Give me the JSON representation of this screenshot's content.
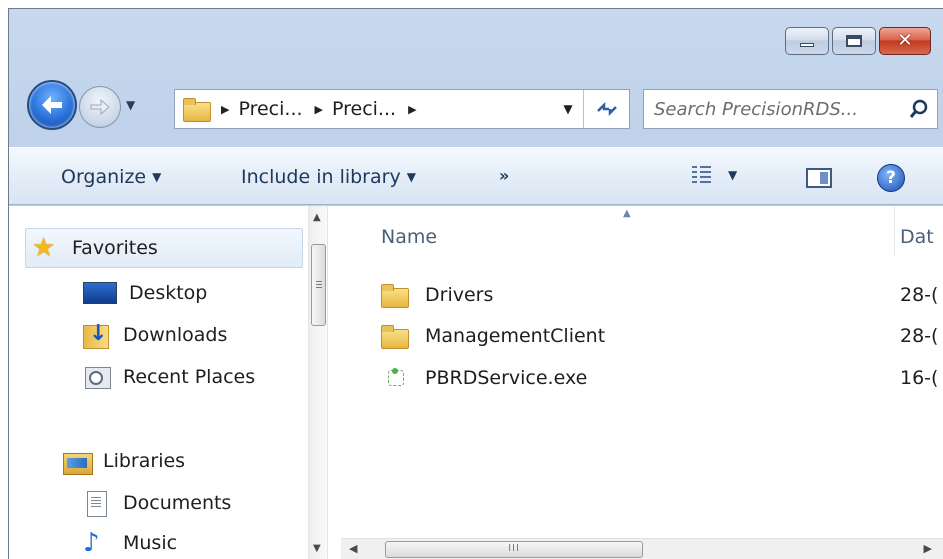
{
  "window": {
    "caption": {
      "minimize_glyph": "",
      "maximize_glyph": "",
      "close_glyph": "✕"
    }
  },
  "address": {
    "crumbs": [
      "Preci...",
      "Preci..."
    ]
  },
  "search": {
    "placeholder": "Search PrecisionRDS..."
  },
  "toolbar": {
    "organize_label": "Organize",
    "include_label": "Include in library",
    "more_label": "»"
  },
  "sidebar": {
    "favorites_label": "Favorites",
    "items_favorites": [
      {
        "label": "Desktop",
        "icon": "desktop-icon"
      },
      {
        "label": "Downloads",
        "icon": "downloads-icon"
      },
      {
        "label": "Recent Places",
        "icon": "recent-places-icon"
      }
    ],
    "libraries_label": "Libraries",
    "items_libraries": [
      {
        "label": "Documents",
        "icon": "documents-icon"
      },
      {
        "label": "Music",
        "icon": "music-icon"
      }
    ]
  },
  "files": {
    "columns": {
      "name": "Name",
      "date": "Dat"
    },
    "rows": [
      {
        "name": "Drivers",
        "date": "28-(",
        "icon": "folder-icon"
      },
      {
        "name": "ManagementClient",
        "date": "28-(",
        "icon": "folder-icon"
      },
      {
        "name": "PBRDService.exe",
        "date": "16-(",
        "icon": "executable-icon"
      }
    ]
  },
  "scrollbar": {
    "grip": "III"
  },
  "colors": {
    "accent": "#2a71d8",
    "close": "#c2391f",
    "window_frame": "#b9cde7"
  }
}
